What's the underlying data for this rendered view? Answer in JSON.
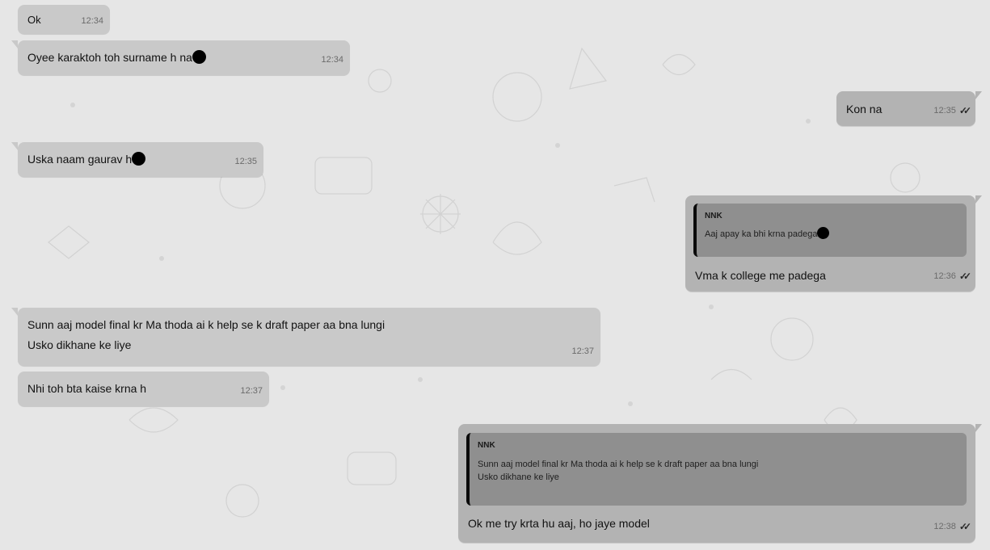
{
  "messages": {
    "m1": {
      "text": "Ok",
      "time": "12:34"
    },
    "m2": {
      "text": "Oyee karaktoh toh surname h na",
      "time": "12:34"
    },
    "m3": {
      "text": "Kon na",
      "time": "12:35"
    },
    "m4": {
      "text": "Uska naam gaurav h",
      "time": "12:35"
    },
    "m5": {
      "quote_author": "NNK",
      "quote_text": "Aaj apay ka bhi krna padega",
      "text": "Vma k college me padega",
      "time": "12:36"
    },
    "m6": {
      "line1": "Sunn aaj model final kr Ma thoda ai k help se k draft paper aa bna lungi",
      "line2": "Usko dikhane ke liye",
      "time": "12:37"
    },
    "m7": {
      "text": "Nhi toh bta kaise krna h",
      "time": "12:37"
    },
    "m8": {
      "quote_author": "NNK",
      "quote_line1": "Sunn aaj model final kr Ma thoda ai k help se k draft paper aa bna lungi",
      "quote_line2": "Usko dikhane ke liye",
      "text": "Ok me try krta hu aaj, ho jaye model",
      "time": "12:38"
    }
  },
  "icons": {
    "read_ticks": "double-check-icon",
    "emoji": "emoji-icon"
  },
  "colors": {
    "background": "#e6e6e6",
    "incoming": "#c9c9c9",
    "outgoing": "#b3b3b3",
    "quote": "#8f8f8f"
  }
}
